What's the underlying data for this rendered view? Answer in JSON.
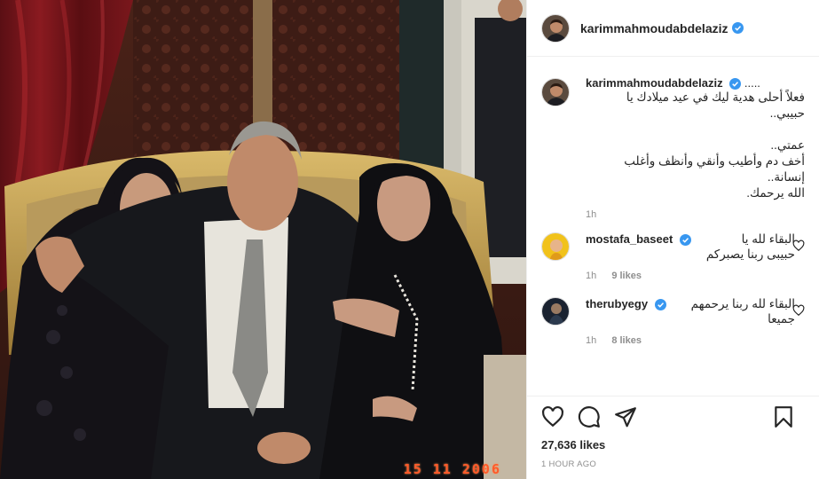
{
  "post": {
    "username": "karimmahmoudabdelaziz",
    "photo_date_stamp": "15  11  2006"
  },
  "caption": {
    "username": "karimmahmoudabdelaziz",
    "lead": ".....",
    "lines": [
      "فعلاً أحلى هدية ليك في عيد ميلادك يا",
      "حبيبي..",
      "",
      "عمتي..",
      "أخف دم وأطيب وأنقي وأنظف وأغلب",
      "إنسانة..",
      "الله يرحمك."
    ],
    "time": "1h"
  },
  "comments": [
    {
      "username": "mostafa_baseet",
      "verified": true,
      "text_first": "البقاء لله يا",
      "text_rest": "حبيبى ربنا يصبركم",
      "time": "1h",
      "likes": "9 likes"
    },
    {
      "username": "therubyegy",
      "verified": true,
      "text_first": "البقاء لله ربنا يرحمهم",
      "text_rest": "جميعا",
      "time": "1h",
      "likes": "8 likes"
    }
  ],
  "footer": {
    "likes": "27,636 likes",
    "posted": "1 HOUR AGO"
  },
  "icons": [
    "heart-icon",
    "comment-icon",
    "share-icon",
    "bookmark-icon",
    "verified-badge-icon"
  ],
  "colors": {
    "verified": "#3897f0",
    "muted": "#8e8e8e",
    "text": "#262626",
    "border": "#efefef"
  }
}
